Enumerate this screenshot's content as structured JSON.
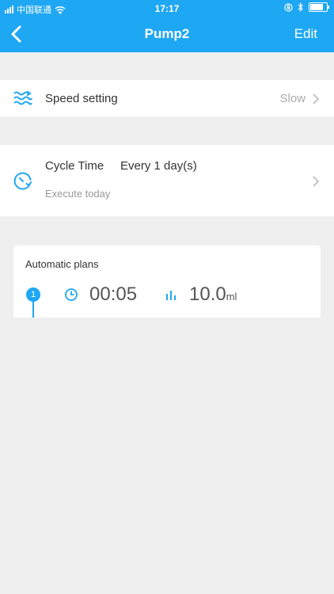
{
  "status_bar": {
    "carrier": "中国联通",
    "time": "17:17"
  },
  "nav": {
    "title": "Pump2",
    "edit_label": "Edit"
  },
  "speed": {
    "label": "Speed setting",
    "value": "Slow"
  },
  "cycle": {
    "label": "Cycle Time",
    "value": "Every 1 day(s)",
    "sub": "Execute today"
  },
  "plans": {
    "title": "Automatic plans",
    "items": [
      {
        "index": "1",
        "time": "00:05",
        "amount": "10.0",
        "unit": "ml"
      }
    ]
  },
  "colors": {
    "accent": "#1ea7f2",
    "background": "#efefef"
  },
  "icons": {
    "back": "chevron-left-icon",
    "speed": "waves-icon",
    "cycle": "timer-icon",
    "clock": "clock-icon",
    "amount": "bars-icon"
  }
}
